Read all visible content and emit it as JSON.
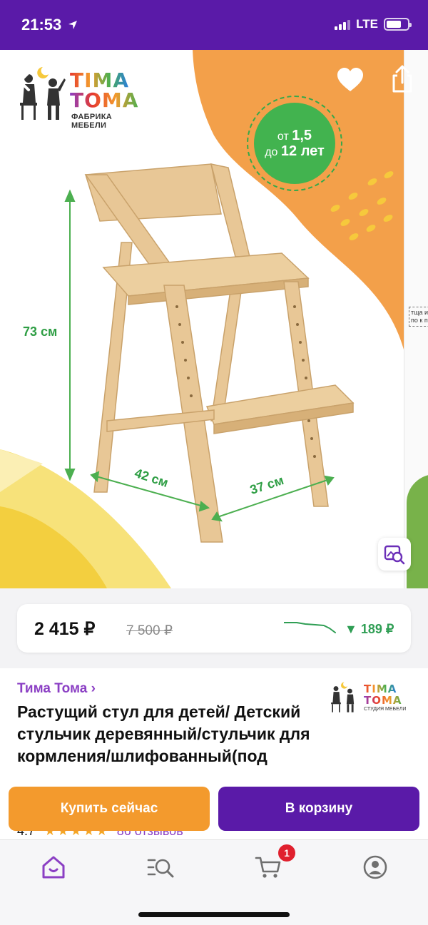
{
  "status_bar": {
    "time": "21:53",
    "network": "LTE",
    "battery_level": 0.7
  },
  "product_image": {
    "logo": {
      "line1": "TIMA",
      "line2": "TOMA",
      "subtitle": "ФАБРИКА МЕБЕЛИ"
    },
    "age_badge": {
      "line1_prefix": "от",
      "line1_value": "1,5",
      "line2_prefix": "до",
      "line2_value": "12 лет"
    },
    "dimensions": {
      "height": "73 см",
      "width": "42 см",
      "depth": "37 см"
    },
    "next_slide_text": "тща и по к по",
    "icons": {
      "back": "back-chevron-icon",
      "favorite": "heart-icon",
      "share": "share-icon",
      "image_search": "image-search-icon"
    }
  },
  "price": {
    "current": "2 415 ₽",
    "old": "7 500 ₽",
    "drop": "▼ 189 ₽",
    "drop_color": "#2f9e54"
  },
  "product": {
    "brand": "Тима Тома ›",
    "title": "Растущий стул для детей/ Детский стульчик деревянный/стульчик для кормления/шлифованный(под",
    "brand_logo": {
      "line1": "TIMA",
      "line2": "TOMA",
      "subtitle": "СТУДИЯ МЕБЕЛИ"
    },
    "rating": "4.7",
    "stars": "★★★★★",
    "reviews": "86 отзывов"
  },
  "actions": {
    "buy_now": "Купить сейчас",
    "add_to_cart": "В корзину"
  },
  "tab_bar": {
    "items": [
      "home-icon",
      "catalog-search-icon",
      "cart-icon",
      "profile-icon"
    ],
    "cart_badge": "1",
    "active_color": "#8b3fc4"
  },
  "colors": {
    "brand_purple": "#5a1aa8",
    "accent_orange": "#f39a2d",
    "badge_green": "#42b34f"
  }
}
